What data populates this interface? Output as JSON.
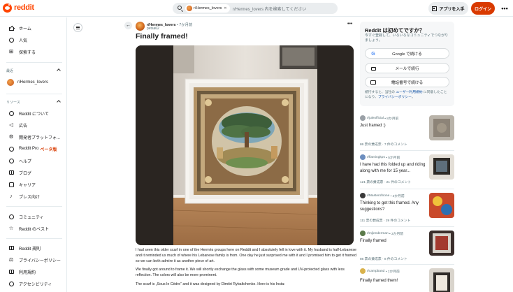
{
  "header": {
    "logo_text": "reddit",
    "search_chip": "r/Hermes_lovers",
    "search_placeholder": "r/Hermes_lovers 内を検索してください",
    "app_button": "アプリを入手",
    "login_button": "ログイン"
  },
  "sidebar": {
    "top_items": [
      {
        "label": "ホーム",
        "icon": "home-icon"
      },
      {
        "label": "人気",
        "icon": "popular-icon"
      },
      {
        "label": "探索する",
        "icon": "explore-icon"
      }
    ],
    "recent_label": "最近",
    "recent_items": [
      {
        "label": "r/Hermes_lovers"
      }
    ],
    "resources_label": "リソース",
    "resource_items": [
      {
        "label": "Reddit について",
        "icon": "reddit-icon"
      },
      {
        "label": "広告",
        "icon": "megaphone-icon"
      },
      {
        "label": "開発者プラットフォ...",
        "icon": "code-icon"
      },
      {
        "label": "Reddit Pro",
        "beta": "ベータ版",
        "icon": "chart-icon"
      },
      {
        "label": "ヘルプ",
        "icon": "help-icon"
      },
      {
        "label": "ブログ",
        "icon": "blog-icon"
      },
      {
        "label": "キャリア",
        "icon": "briefcase-icon"
      },
      {
        "label": "プレス向け",
        "icon": "mic-icon"
      }
    ],
    "community_items": [
      {
        "label": "コミュニティ",
        "icon": "community-icon"
      },
      {
        "label": "Reddit のベスト",
        "icon": "star-icon"
      }
    ],
    "policy_items": [
      {
        "label": "Reddit 規則",
        "icon": "rules-icon"
      },
      {
        "label": "プライバシーポリシー",
        "icon": "privacy-icon"
      },
      {
        "label": "利用規約",
        "icon": "terms-icon"
      },
      {
        "label": "アクセシビリティ",
        "icon": "accessibility-icon"
      }
    ]
  },
  "post": {
    "subreddit": "r/Hermes_lovers",
    "time": "• 7か月前",
    "author": "petsa62",
    "title": "Finally framed!",
    "paragraphs": [
      "I had seen this older scarf in one of the Hermès groups here on Reddit and I absolutely fell in love with it. My husband is half-Lebanese and it reminded us much of where his Lebanese family is from. One day he just surprised me with it and I promised him to get it framed so we can both admire it as another piece of art.",
      "We finally got around to frame it. We will shortly exchange the glass with some museum grade and UV-protected glass with less reflection. The colors will also be more prominent.",
      "The scarf is „Sous le Cèdre“ and it was designed by Dimitri Rybaltchenko. Here is his Insta:"
    ]
  },
  "login_card": {
    "title": "Reddit は初めてですか？",
    "subtitle": "今すぐ登録して、いろいろなコミュニティでつながりましょう。",
    "google_button": "Google で続ける",
    "email_button": "メールで続行",
    "phone_button": "電話番号で続ける",
    "legal_prefix": "続行すると、当社の ",
    "legal_terms": "ユーザー利用規約",
    "legal_middle": " に同意したことになり、",
    "legal_privacy": "プライバシーポリシー",
    "legal_suffix": "。"
  },
  "related": [
    {
      "sub": "r/juleofficial",
      "time": "• 8か月前",
      "title": "Just framed :)",
      "stats": "86 票の賛成票 · 7 件のコメント"
    },
    {
      "sub": "r/flamingkps",
      "time": "• 5か月前",
      "title": "I have had this folded up and riding along with me for 15 year...",
      "stats": "121 票の賛成票 · 21 件のコメント"
    },
    {
      "sub": "r/Masterofnone",
      "time": "• 4か月前",
      "title": "Thinking to get this framed. Any suggestions?",
      "stats": "111 票の賛成票 · 29 件のコメント"
    },
    {
      "sub": "r/mjlenderman",
      "time": "• 3か月前",
      "title": "Finally framed",
      "stats": "86 票の賛成票 · 8 件のコメント"
    },
    {
      "sub": "r/campband",
      "time": "• 1か月前",
      "title": "Finally framed them!",
      "stats": ""
    }
  ]
}
